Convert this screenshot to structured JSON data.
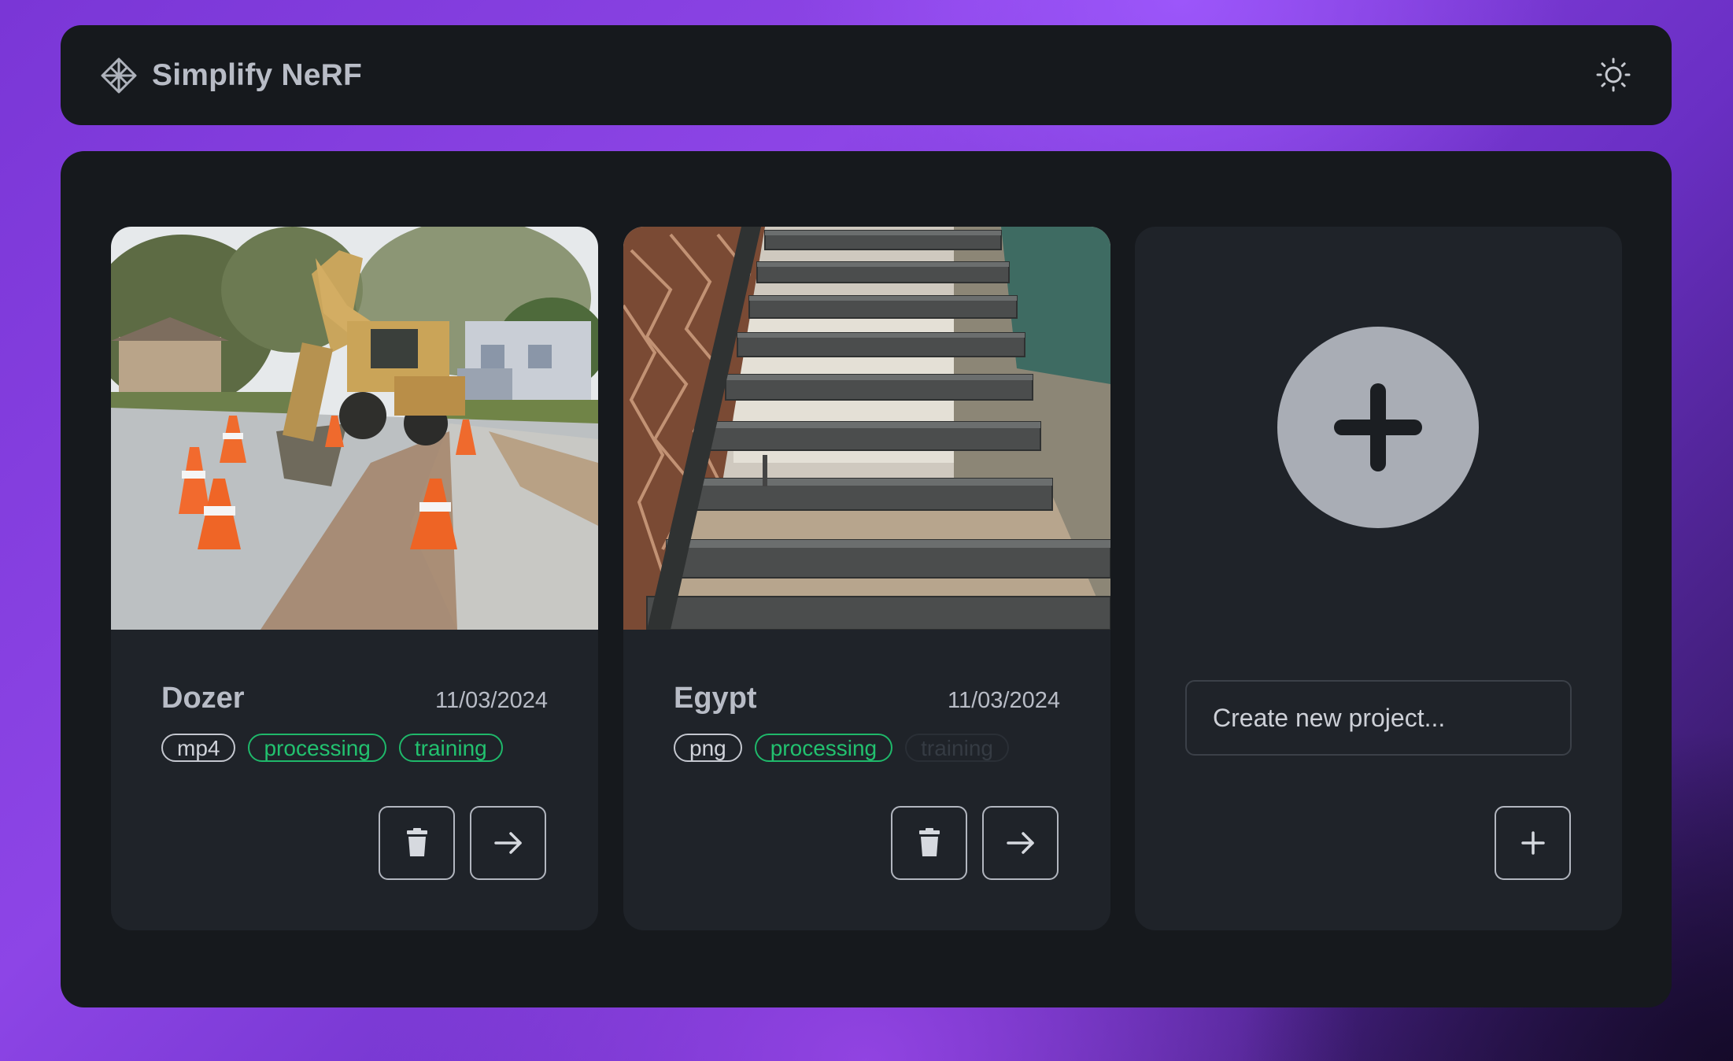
{
  "app": {
    "title": "Simplify NeRF",
    "logo_icon": "diamond-logo-icon",
    "theme_toggle_icon": "sun-icon"
  },
  "projects": [
    {
      "name": "Dozer",
      "date": "11/03/2024",
      "thumbnail": "excavator on street with traffic cones",
      "tags": [
        {
          "label": "mp4",
          "style": "neutral"
        },
        {
          "label": "processing",
          "style": "green"
        },
        {
          "label": "training",
          "style": "green"
        }
      ],
      "delete_icon": "trash-icon",
      "open_icon": "arrow-right-icon"
    },
    {
      "name": "Egypt",
      "date": "11/03/2024",
      "thumbnail": "metal staircase with decorative screen",
      "tags": [
        {
          "label": "png",
          "style": "neutral"
        },
        {
          "label": "processing",
          "style": "green"
        },
        {
          "label": "training",
          "style": "disabled"
        }
      ],
      "delete_icon": "trash-icon",
      "open_icon": "arrow-right-icon"
    }
  ],
  "new_project": {
    "placeholder": "Create new project...",
    "hero_icon": "plus-circle-icon",
    "add_icon": "plus-icon"
  },
  "colors": {
    "panel": "#16191d",
    "card": "#1f2329",
    "accent_green": "#22c16f",
    "text": "#b8bcc6"
  }
}
